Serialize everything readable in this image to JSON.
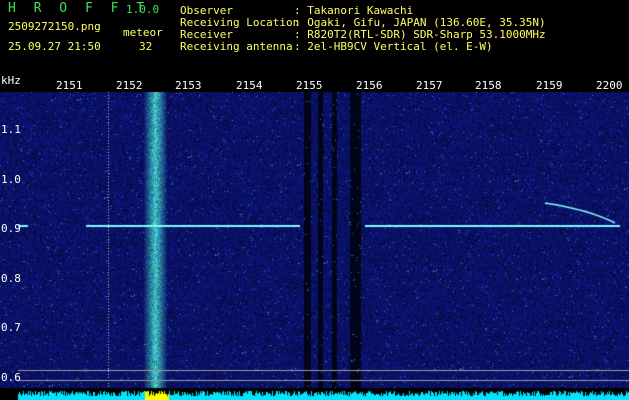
{
  "header": {
    "app_title": "H R O F F T",
    "version": "1.0.0",
    "filename": "2509272150.png",
    "datetime": "25.09.27 21:50",
    "meteor_label": "meteor",
    "meteor_count": "32",
    "info_labels": [
      "Observer",
      "Receiving Location",
      "Receiver",
      "Receiving antenna"
    ],
    "info_values": [
      ": Takanori Kawachi",
      ": Ogaki, Gifu, JAPAN (136.60E, 35.35N)",
      ": R820T2(RTL-SDR) SDR-Sharp 53.1000MHz",
      ": 2el-HB9CV Vertical (el. E-W)"
    ]
  },
  "axes": {
    "y_unit": "kHz",
    "x_ticks": [
      "2151",
      "2152",
      "2153",
      "2154",
      "2155",
      "2156",
      "2157",
      "2158",
      "2159",
      "2200"
    ],
    "y_ticks": [
      "1.1",
      "1.0",
      "0.9",
      "0.8",
      "0.7",
      "0.6"
    ]
  },
  "colors": {
    "background": "#000000",
    "title_green": "#3fe05a",
    "header_yellow": "#ffff66",
    "noise_blue": "#1c2a9a",
    "signal_cyan": "#7ffcff",
    "level_bar_cyan": "#00e5ff",
    "level_bar_yellow": "#ffff00"
  }
}
